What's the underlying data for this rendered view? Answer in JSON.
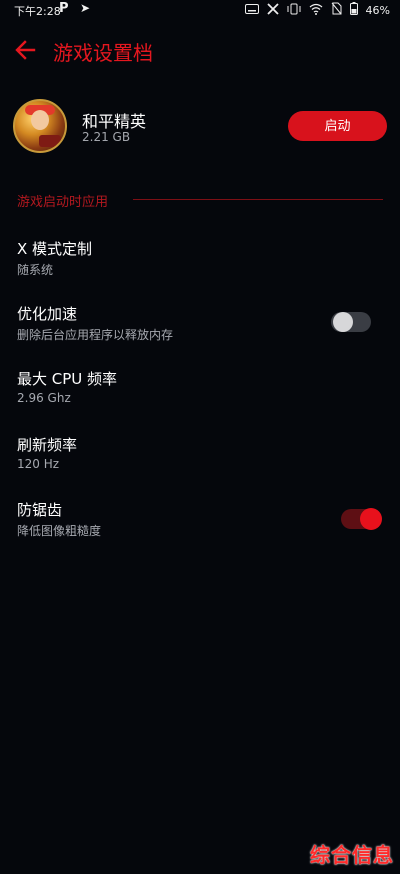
{
  "status_bar": {
    "time": "下午2:28",
    "p_icon_text": "P",
    "battery": "46%"
  },
  "app_bar": {
    "title": "游戏设置档"
  },
  "game": {
    "name": "和平精英",
    "size": "2.21 GB",
    "launch_label": "启动"
  },
  "section": {
    "title": "游戏启动时应用"
  },
  "settings": [
    {
      "title": "X 模式定制",
      "subtitle": "随系统"
    },
    {
      "title": "优化加速",
      "subtitle": "删除后台应用程序以释放内存",
      "toggle": false
    },
    {
      "title": "最大 CPU 频率",
      "subtitle": "2.96 Ghz"
    },
    {
      "title": "刷新频率",
      "subtitle": "120 Hz"
    },
    {
      "title": "防锯齿",
      "subtitle": "降低图像粗糙度",
      "toggle": true
    }
  ],
  "watermark": "综合信息",
  "colors": {
    "accent": "#e5171f",
    "background": "#05070c",
    "launch_button": "#d8121c"
  }
}
